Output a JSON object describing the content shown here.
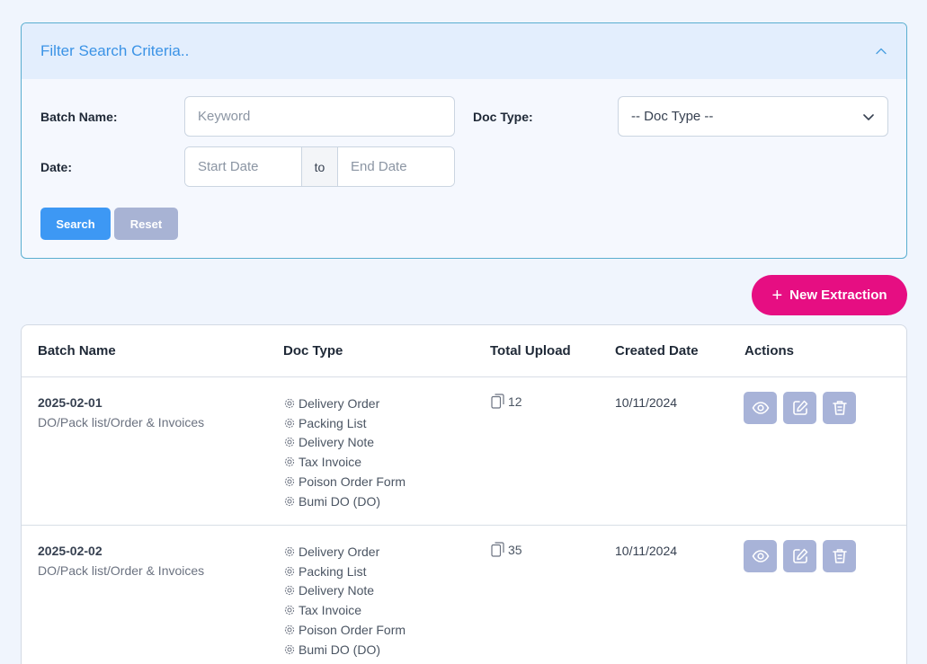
{
  "filter": {
    "title": "Filter Search Criteria..",
    "batch_label": "Batch Name:",
    "batch_placeholder": "Keyword",
    "doctype_label": "Doc Type:",
    "doctype_selected": "-- Doc Type --",
    "date_label": "Date:",
    "start_placeholder": "Start Date",
    "to_label": "to",
    "end_placeholder": "End Date",
    "search_label": "Search",
    "reset_label": "Reset"
  },
  "new_extraction_label": "New Extraction",
  "table": {
    "headers": [
      "Batch Name",
      "Doc Type",
      "Total Upload",
      "Created Date",
      "Actions"
    ],
    "rows": [
      {
        "name": "2025-02-01",
        "desc": "DO/Pack list/Order & Invoices",
        "doc_types": [
          "Delivery Order",
          "Packing List",
          "Delivery Note",
          "Tax Invoice",
          "Poison Order Form",
          "Bumi DO (DO)"
        ],
        "total": "12",
        "created": "10/11/2024"
      },
      {
        "name": "2025-02-02",
        "desc": "DO/Pack list/Order & Invoices",
        "doc_types": [
          "Delivery Order",
          "Packing List",
          "Delivery Note",
          "Tax Invoice",
          "Poison Order Form",
          "Bumi DO (DO)"
        ],
        "total": "35",
        "created": "10/11/2024"
      }
    ]
  },
  "colors": {
    "accent": "#3d98f4",
    "brand": "#e60e82",
    "muted_button": "#a8b3d8"
  },
  "icons": [
    "chevron-up-icon",
    "chevron-down-icon",
    "plus-icon",
    "gear-icon",
    "copy-icon",
    "eye-icon",
    "edit-icon",
    "trash-icon"
  ]
}
